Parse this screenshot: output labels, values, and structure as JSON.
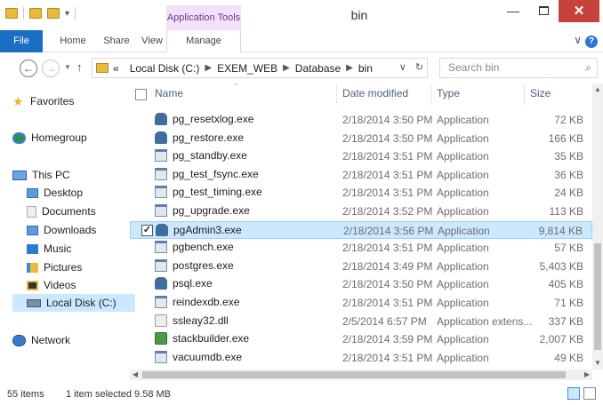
{
  "window": {
    "title": "bin",
    "context_tab_label": "Application Tools",
    "minimize": "—",
    "close": "✕"
  },
  "ribbon": {
    "tabs": [
      "File",
      "Home",
      "Share",
      "View",
      "Manage"
    ],
    "help_chevron": "∨",
    "help_icon": "?"
  },
  "nav": {
    "back": "←",
    "forward": "→",
    "up": "↑",
    "breadcrumb_prefix": "«",
    "breadcrumbs": [
      "Local Disk (C:)",
      "EXEM_WEB",
      "Database",
      "bin"
    ],
    "search_placeholder": "Search bin"
  },
  "sidebar": {
    "favorites": "Favorites",
    "homegroup": "Homegroup",
    "this_pc": "This PC",
    "items": [
      "Desktop",
      "Documents",
      "Downloads",
      "Music",
      "Pictures",
      "Videos",
      "Local Disk (C:)"
    ],
    "network": "Network"
  },
  "list": {
    "columns": [
      "Name",
      "Date modified",
      "Type",
      "Size"
    ],
    "rows": [
      {
        "name": "pg_resetxlog.exe",
        "date": "2/18/2014 3:50 PM",
        "type": "Application",
        "size": "72 KB",
        "icon": "postgres-elephant-icon"
      },
      {
        "name": "pg_restore.exe",
        "date": "2/18/2014 3:50 PM",
        "type": "Application",
        "size": "166 KB",
        "icon": "postgres-elephant-icon"
      },
      {
        "name": "pg_standby.exe",
        "date": "2/18/2014 3:51 PM",
        "type": "Application",
        "size": "35 KB",
        "icon": "exe-icon"
      },
      {
        "name": "pg_test_fsync.exe",
        "date": "2/18/2014 3:51 PM",
        "type": "Application",
        "size": "36 KB",
        "icon": "exe-icon"
      },
      {
        "name": "pg_test_timing.exe",
        "date": "2/18/2014 3:51 PM",
        "type": "Application",
        "size": "24 KB",
        "icon": "exe-icon"
      },
      {
        "name": "pg_upgrade.exe",
        "date": "2/18/2014 3:52 PM",
        "type": "Application",
        "size": "113 KB",
        "icon": "exe-icon"
      },
      {
        "name": "pgAdmin3.exe",
        "date": "2/18/2014 3:56 PM",
        "type": "Application",
        "size": "9,814 KB",
        "icon": "postgres-elephant-icon",
        "selected": true
      },
      {
        "name": "pgbench.exe",
        "date": "2/18/2014 3:51 PM",
        "type": "Application",
        "size": "57 KB",
        "icon": "exe-icon"
      },
      {
        "name": "postgres.exe",
        "date": "2/18/2014 3:49 PM",
        "type": "Application",
        "size": "5,403 KB",
        "icon": "exe-icon"
      },
      {
        "name": "psql.exe",
        "date": "2/18/2014 3:50 PM",
        "type": "Application",
        "size": "405 KB",
        "icon": "postgres-elephant-icon"
      },
      {
        "name": "reindexdb.exe",
        "date": "2/18/2014 3:51 PM",
        "type": "Application",
        "size": "71 KB",
        "icon": "exe-icon"
      },
      {
        "name": "ssleay32.dll",
        "date": "2/5/2014 6:57 PM",
        "type": "Application extens...",
        "size": "337 KB",
        "icon": "dll-icon"
      },
      {
        "name": "stackbuilder.exe",
        "date": "2/18/2014 3:59 PM",
        "type": "Application",
        "size": "2,007 KB",
        "icon": "stackbuilder-icon"
      },
      {
        "name": "vacuumdb.exe",
        "date": "2/18/2014 3:51 PM",
        "type": "Application",
        "size": "49 KB",
        "icon": "exe-icon"
      }
    ]
  },
  "status": {
    "item_count": "55 items",
    "selection": "1 item selected  9.58 MB"
  },
  "colors": {
    "file_tab": "#1a6fc4",
    "context_tab": "#f4e0f9",
    "selection": "#cce8ff",
    "close_button": "#c7423a"
  }
}
